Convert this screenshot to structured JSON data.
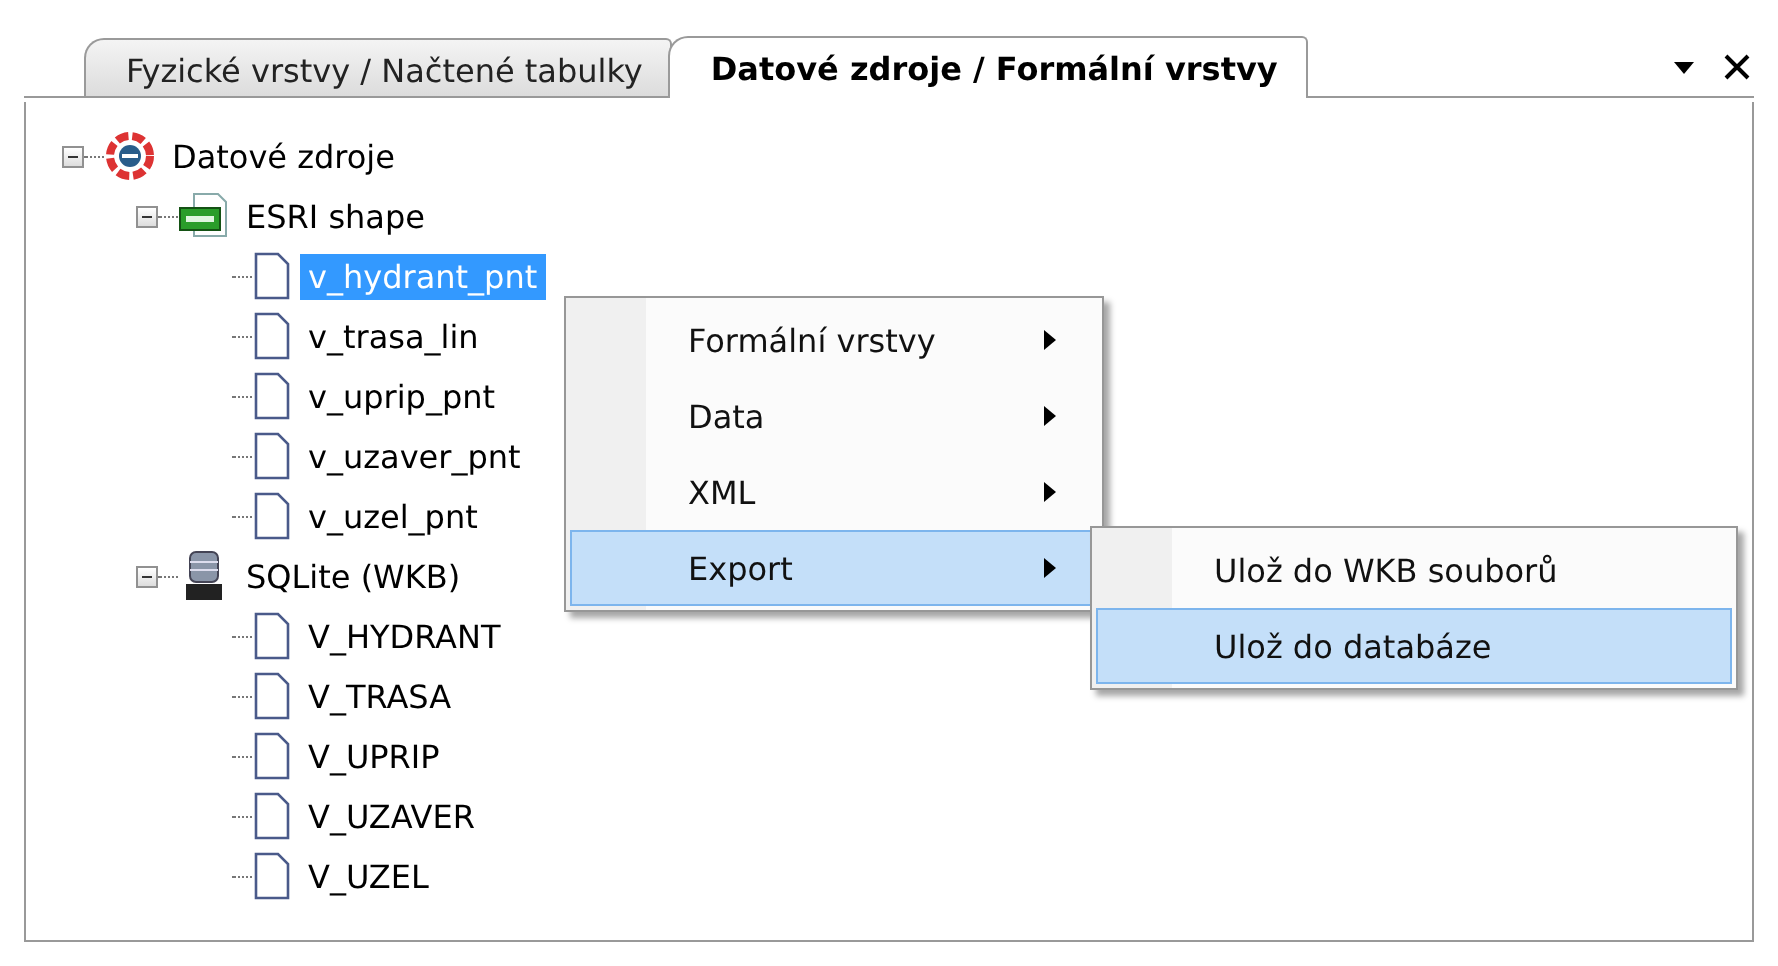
{
  "tabs": [
    {
      "label": "Fyzické vrstvy / Načtené tabulky",
      "selected": false
    },
    {
      "label": "Datové zdroje / Formální vrstvy",
      "selected": true
    }
  ],
  "tree": [
    {
      "label": "Datové zdroje",
      "kind": "root",
      "expanded": true,
      "selected": false,
      "children": [
        {
          "label": "ESRI shape",
          "kind": "shapefile",
          "expanded": true,
          "selected": false,
          "children": [
            {
              "label": "v_hydrant_pnt",
              "kind": "table",
              "selected": true
            },
            {
              "label": "v_trasa_lin",
              "kind": "table",
              "selected": false
            },
            {
              "label": "v_uprip_pnt",
              "kind": "table",
              "selected": false
            },
            {
              "label": "v_uzaver_pnt",
              "kind": "table",
              "selected": false
            },
            {
              "label": "v_uzel_pnt",
              "kind": "table",
              "selected": false
            }
          ]
        },
        {
          "label": "SQLite (WKB)",
          "kind": "database",
          "expanded": true,
          "selected": false,
          "children": [
            {
              "label": "V_HYDRANT",
              "kind": "table",
              "selected": false
            },
            {
              "label": "V_TRASA",
              "kind": "table",
              "selected": false
            },
            {
              "label": "V_UPRIP",
              "kind": "table",
              "selected": false
            },
            {
              "label": "V_UZAVER",
              "kind": "table",
              "selected": false
            },
            {
              "label": "V_UZEL",
              "kind": "table",
              "selected": false
            }
          ]
        }
      ]
    }
  ],
  "context_menu": {
    "items": [
      {
        "label": "Formální vrstvy",
        "selected": false,
        "has_submenu": true
      },
      {
        "label": "Data",
        "selected": false,
        "has_submenu": true
      },
      {
        "label": "XML",
        "selected": false,
        "has_submenu": true
      },
      {
        "label": "Export",
        "selected": true,
        "has_submenu": true
      }
    ]
  },
  "submenu": {
    "items": [
      {
        "label": "Ulož do WKB souborů",
        "selected": false
      },
      {
        "label": "Ulož do databáze",
        "selected": true
      }
    ]
  }
}
